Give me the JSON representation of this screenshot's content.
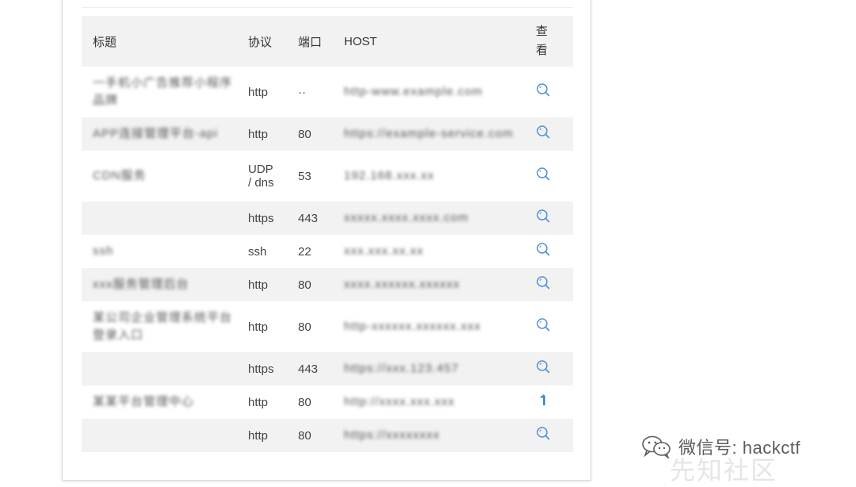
{
  "table": {
    "headers": {
      "title": "标题",
      "protocol": "协议",
      "port": "端口",
      "host": "HOST",
      "view": "查看"
    },
    "rows": [
      {
        "title": "一手机小广告推荐小程序\n品牌",
        "protocol": "http",
        "port": "··",
        "host": "http-www.example.com",
        "view_icon": "magnifier-icon"
      },
      {
        "title": "APP连接管理平台-api",
        "protocol": "http",
        "port": "80",
        "host": "https://example-service.com",
        "view_icon": "magnifier-icon"
      },
      {
        "title": "CDN服务",
        "protocol": "UDP\n/ dns",
        "port": "53",
        "host": "192.168.xxx.xx",
        "view_icon": "magnifier-icon"
      },
      {
        "title": "",
        "protocol": "https",
        "port": "443",
        "host": "xxxxx.xxxx.xxxx.com",
        "view_icon": "magnifier-icon"
      },
      {
        "title": "ssh",
        "protocol": "ssh",
        "port": "22",
        "host": "xxx.xxx.xx.xx",
        "view_icon": "magnifier-icon"
      },
      {
        "title": "xxx服务管理后台",
        "protocol": "http",
        "port": "80",
        "host": "xxxx.xxxxxx.xxxxxx",
        "view_icon": "magnifier-icon"
      },
      {
        "title": "某公司企业管理系统平台\n登录入口",
        "protocol": "http",
        "port": "80",
        "host": "http-xxxxxx.xxxxxx.xxx",
        "view_icon": "magnifier-icon"
      },
      {
        "title": "",
        "protocol": "https",
        "port": "443",
        "host": "https://xxx.123.457",
        "view_icon": "magnifier-icon"
      },
      {
        "title": "某某平台管理中心",
        "protocol": "http",
        "port": "80",
        "host": "http://xxxx.xxx.xxx",
        "view_icon": "cursor-icon"
      },
      {
        "title": "",
        "protocol": "http",
        "port": "80",
        "host": "https://xxxxxxxx",
        "view_icon": "magnifier-icon"
      }
    ]
  },
  "watermark": {
    "text": "微信号: hackctf",
    "ghost": "先知社区",
    "icon": "wechat-icon"
  },
  "colors": {
    "accent": "#4a8fd8",
    "row_alt": "#f2f2f2"
  }
}
